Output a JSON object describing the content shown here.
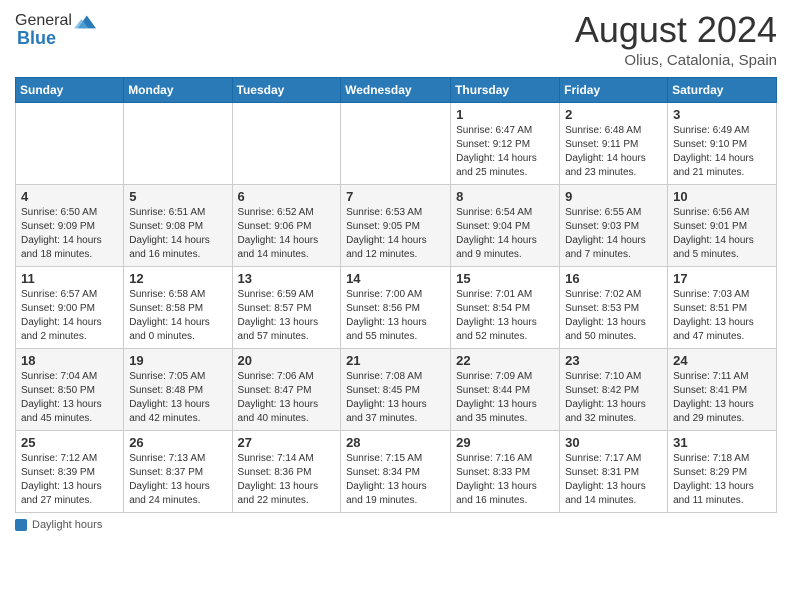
{
  "header": {
    "logo_general": "General",
    "logo_blue": "Blue",
    "title": "August 2024",
    "location": "Olius, Catalonia, Spain"
  },
  "calendar": {
    "days_of_week": [
      "Sunday",
      "Monday",
      "Tuesday",
      "Wednesday",
      "Thursday",
      "Friday",
      "Saturday"
    ],
    "weeks": [
      [
        {
          "day": "",
          "info": ""
        },
        {
          "day": "",
          "info": ""
        },
        {
          "day": "",
          "info": ""
        },
        {
          "day": "",
          "info": ""
        },
        {
          "day": "1",
          "info": "Sunrise: 6:47 AM\nSunset: 9:12 PM\nDaylight: 14 hours and 25 minutes."
        },
        {
          "day": "2",
          "info": "Sunrise: 6:48 AM\nSunset: 9:11 PM\nDaylight: 14 hours and 23 minutes."
        },
        {
          "day": "3",
          "info": "Sunrise: 6:49 AM\nSunset: 9:10 PM\nDaylight: 14 hours and 21 minutes."
        }
      ],
      [
        {
          "day": "4",
          "info": "Sunrise: 6:50 AM\nSunset: 9:09 PM\nDaylight: 14 hours and 18 minutes."
        },
        {
          "day": "5",
          "info": "Sunrise: 6:51 AM\nSunset: 9:08 PM\nDaylight: 14 hours and 16 minutes."
        },
        {
          "day": "6",
          "info": "Sunrise: 6:52 AM\nSunset: 9:06 PM\nDaylight: 14 hours and 14 minutes."
        },
        {
          "day": "7",
          "info": "Sunrise: 6:53 AM\nSunset: 9:05 PM\nDaylight: 14 hours and 12 minutes."
        },
        {
          "day": "8",
          "info": "Sunrise: 6:54 AM\nSunset: 9:04 PM\nDaylight: 14 hours and 9 minutes."
        },
        {
          "day": "9",
          "info": "Sunrise: 6:55 AM\nSunset: 9:03 PM\nDaylight: 14 hours and 7 minutes."
        },
        {
          "day": "10",
          "info": "Sunrise: 6:56 AM\nSunset: 9:01 PM\nDaylight: 14 hours and 5 minutes."
        }
      ],
      [
        {
          "day": "11",
          "info": "Sunrise: 6:57 AM\nSunset: 9:00 PM\nDaylight: 14 hours and 2 minutes."
        },
        {
          "day": "12",
          "info": "Sunrise: 6:58 AM\nSunset: 8:58 PM\nDaylight: 14 hours and 0 minutes."
        },
        {
          "day": "13",
          "info": "Sunrise: 6:59 AM\nSunset: 8:57 PM\nDaylight: 13 hours and 57 minutes."
        },
        {
          "day": "14",
          "info": "Sunrise: 7:00 AM\nSunset: 8:56 PM\nDaylight: 13 hours and 55 minutes."
        },
        {
          "day": "15",
          "info": "Sunrise: 7:01 AM\nSunset: 8:54 PM\nDaylight: 13 hours and 52 minutes."
        },
        {
          "day": "16",
          "info": "Sunrise: 7:02 AM\nSunset: 8:53 PM\nDaylight: 13 hours and 50 minutes."
        },
        {
          "day": "17",
          "info": "Sunrise: 7:03 AM\nSunset: 8:51 PM\nDaylight: 13 hours and 47 minutes."
        }
      ],
      [
        {
          "day": "18",
          "info": "Sunrise: 7:04 AM\nSunset: 8:50 PM\nDaylight: 13 hours and 45 minutes."
        },
        {
          "day": "19",
          "info": "Sunrise: 7:05 AM\nSunset: 8:48 PM\nDaylight: 13 hours and 42 minutes."
        },
        {
          "day": "20",
          "info": "Sunrise: 7:06 AM\nSunset: 8:47 PM\nDaylight: 13 hours and 40 minutes."
        },
        {
          "day": "21",
          "info": "Sunrise: 7:08 AM\nSunset: 8:45 PM\nDaylight: 13 hours and 37 minutes."
        },
        {
          "day": "22",
          "info": "Sunrise: 7:09 AM\nSunset: 8:44 PM\nDaylight: 13 hours and 35 minutes."
        },
        {
          "day": "23",
          "info": "Sunrise: 7:10 AM\nSunset: 8:42 PM\nDaylight: 13 hours and 32 minutes."
        },
        {
          "day": "24",
          "info": "Sunrise: 7:11 AM\nSunset: 8:41 PM\nDaylight: 13 hours and 29 minutes."
        }
      ],
      [
        {
          "day": "25",
          "info": "Sunrise: 7:12 AM\nSunset: 8:39 PM\nDaylight: 13 hours and 27 minutes."
        },
        {
          "day": "26",
          "info": "Sunrise: 7:13 AM\nSunset: 8:37 PM\nDaylight: 13 hours and 24 minutes."
        },
        {
          "day": "27",
          "info": "Sunrise: 7:14 AM\nSunset: 8:36 PM\nDaylight: 13 hours and 22 minutes."
        },
        {
          "day": "28",
          "info": "Sunrise: 7:15 AM\nSunset: 8:34 PM\nDaylight: 13 hours and 19 minutes."
        },
        {
          "day": "29",
          "info": "Sunrise: 7:16 AM\nSunset: 8:33 PM\nDaylight: 13 hours and 16 minutes."
        },
        {
          "day": "30",
          "info": "Sunrise: 7:17 AM\nSunset: 8:31 PM\nDaylight: 13 hours and 14 minutes."
        },
        {
          "day": "31",
          "info": "Sunrise: 7:18 AM\nSunset: 8:29 PM\nDaylight: 13 hours and 11 minutes."
        }
      ]
    ]
  },
  "footer": {
    "daylight_label": "Daylight hours"
  }
}
